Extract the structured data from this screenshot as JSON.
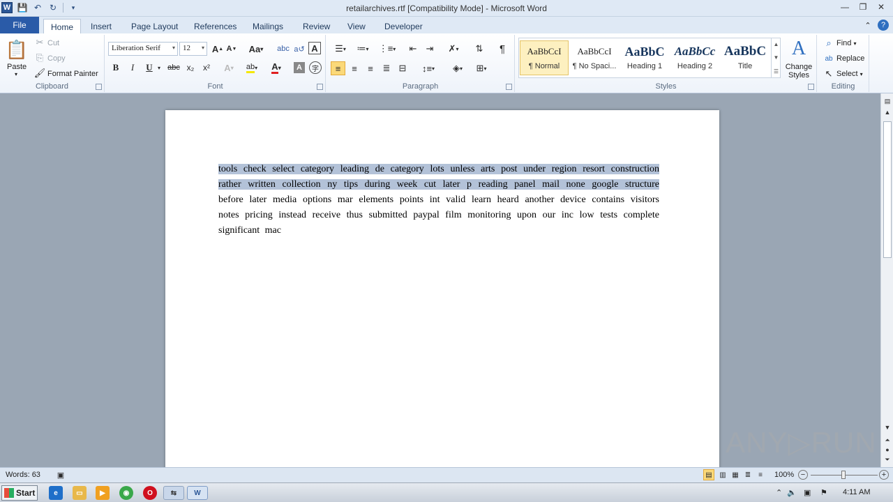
{
  "window": {
    "title": "retailarchives.rtf [Compatibility Mode]  -  Microsoft Word",
    "app_icon": "W"
  },
  "tabs": {
    "file": "File",
    "items": [
      "Home",
      "Insert",
      "Page Layout",
      "References",
      "Mailings",
      "Review",
      "View",
      "Developer"
    ],
    "active": "Home"
  },
  "clipboard": {
    "paste": "Paste",
    "cut": "Cut",
    "copy": "Copy",
    "format_painter": "Format Painter",
    "label": "Clipboard"
  },
  "font": {
    "family": "Liberation Serif",
    "size": "12",
    "label": "Font",
    "bold": "B",
    "italic": "I",
    "underline": "U",
    "strike": "abc",
    "subscript": "x₂",
    "superscript": "x²",
    "grow": "A",
    "shrink": "A",
    "case": "Aa",
    "clear": "A",
    "char_border": "A",
    "font_color": "A",
    "highlight": "ab",
    "text_effects": "A",
    "char_shading": "A",
    "enclose": "字",
    "phonetic": "abc",
    "ruby": "文"
  },
  "paragraph": {
    "label": "Paragraph",
    "pilcrow": "¶"
  },
  "styles": {
    "label": "Styles",
    "items": [
      {
        "preview": "AaBbCcI",
        "name": "¶ Normal"
      },
      {
        "preview": "AaBbCcI",
        "name": "¶ No Spaci..."
      },
      {
        "preview": "AaBbC",
        "name": "Heading 1"
      },
      {
        "preview": "AaBbCc",
        "name": "Heading 2"
      },
      {
        "preview": "AaBbC",
        "name": "Title"
      }
    ],
    "change_styles_line1": "Change",
    "change_styles_line2": "Styles"
  },
  "editing": {
    "label": "Editing",
    "find": "Find",
    "replace": "Replace",
    "select": "Select"
  },
  "document": {
    "highlighted_text": " tools  check  select  category        leading  de category  lots  unless  arts post    under  region     resort construction     rather     written  collection  ny tips  during  week cut    later p reading  panel mail  none google  structure    ",
    "plain_text": "before later  media  options  mar    elements  points     int  valid     learn  heard another      device  contains  visitors  notes pricing  instead  receive  thus     submitted        paypal     film monitoring  upon     our inc      low tests      complete  significant  mac"
  },
  "status": {
    "words": "Words: 63",
    "zoom": "100%"
  },
  "taskbar": {
    "start": "Start",
    "time": "4:11 AM"
  },
  "watermark": "ANY▷RUN"
}
